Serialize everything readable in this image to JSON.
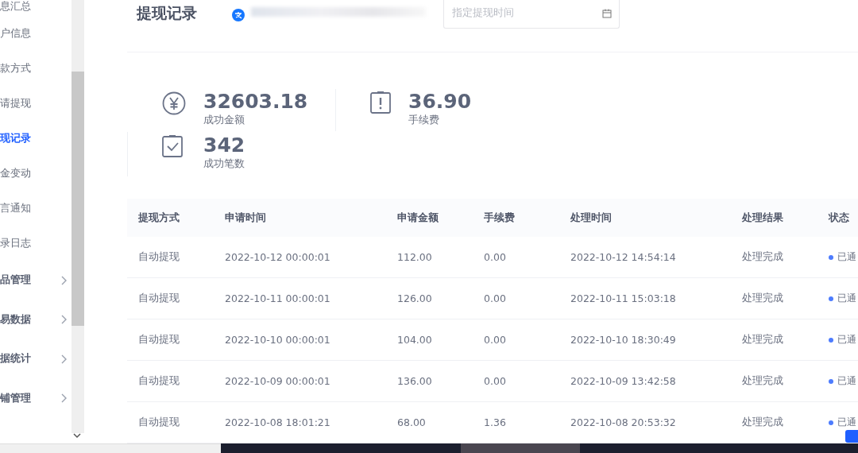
{
  "sidebar": {
    "items": [
      {
        "label": "息汇总",
        "selected": false,
        "has_children": false
      },
      {
        "label": "户信息",
        "selected": false,
        "has_children": false
      },
      {
        "label": "款方式",
        "selected": false,
        "has_children": false
      },
      {
        "label": "请提现",
        "selected": false,
        "has_children": false
      },
      {
        "label": "现记录",
        "selected": true,
        "has_children": false
      },
      {
        "label": "金变动",
        "selected": false,
        "has_children": false
      },
      {
        "label": "言通知",
        "selected": false,
        "has_children": false
      },
      {
        "label": "录日志",
        "selected": false,
        "has_children": false
      },
      {
        "label": "品管理",
        "selected": false,
        "has_children": true
      },
      {
        "label": "易数据",
        "selected": false,
        "has_children": true
      },
      {
        "label": "据统计",
        "selected": false,
        "has_children": true
      },
      {
        "label": "铺管理",
        "selected": false,
        "has_children": true
      }
    ]
  },
  "header": {
    "title": "提现记录",
    "date_field": {
      "placeholder": "指定提现时间"
    }
  },
  "stats": [
    {
      "kind": "amount",
      "value": "32603.18",
      "label": "成功金额"
    },
    {
      "kind": "fee",
      "value": "36.90",
      "label": "手续费"
    },
    {
      "kind": "count",
      "value": "342",
      "label": "成功笔数"
    }
  ],
  "table": {
    "columns": [
      "提现方式",
      "申请时间",
      "申请金额",
      "手续费",
      "处理时间",
      "处理结果",
      "状态"
    ],
    "rows": [
      {
        "cells": [
          "自动提现",
          "2022-10-12 00:00:01",
          "112.00",
          "0.00",
          "2022-10-12 14:54:14",
          "处理完成",
          "已通"
        ],
        "color": "#4d7cfe"
      },
      {
        "cells": [
          "自动提现",
          "2022-10-11 00:00:01",
          "126.00",
          "0.00",
          "2022-10-11 15:03:18",
          "处理完成",
          "已通"
        ],
        "color": "#4d7cfe"
      },
      {
        "cells": [
          "自动提现",
          "2022-10-10 00:00:01",
          "104.00",
          "0.00",
          "2022-10-10 18:30:49",
          "处理完成",
          "已通"
        ],
        "color": "#4d7cfe"
      },
      {
        "cells": [
          "自动提现",
          "2022-10-09 00:00:01",
          "136.00",
          "0.00",
          "2022-10-09 13:42:58",
          "处理完成",
          "已通"
        ],
        "color": "#4d7cfe"
      },
      {
        "cells": [
          "自动提现",
          "2022-10-08 18:01:21",
          "68.00",
          "1.36",
          "2022-10-08 20:53:32",
          "处理完成",
          "已通"
        ],
        "color": "#4d7cfe"
      }
    ]
  }
}
